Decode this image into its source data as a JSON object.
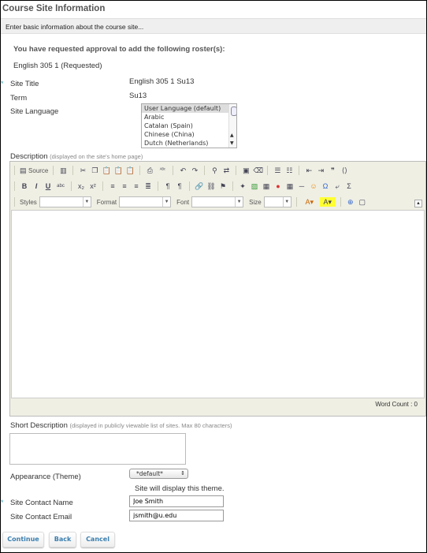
{
  "title": "Course Site Information",
  "instructions": "Enter basic information about the course site...",
  "roster_heading": "You have requested approval to add the following roster(s):",
  "roster_item": "English 305 1 (Requested)",
  "fields": {
    "site_title": {
      "label": "Site Title",
      "value": "English 305 1 Su13",
      "required_mark": "*"
    },
    "term": {
      "label": "Term",
      "value": "Su13"
    },
    "site_language": {
      "label": "Site Language",
      "options": [
        "User Language (default)",
        "Arabic",
        "Catalan (Spain)",
        "Chinese (China)",
        "Dutch (Netherlands)"
      ],
      "selected": "User Language (default)"
    },
    "description": {
      "label": "Description",
      "hint": "(displayed on the site's home page)",
      "word_count": "Word Count : 0"
    },
    "short_description": {
      "label": "Short Description",
      "hint": "(displayed in publicly viewable list of sites. Max 80 characters)",
      "value": ""
    },
    "appearance": {
      "label": "Appearance (Theme)",
      "selected": "*default*",
      "note": "Site will display this theme."
    },
    "contact_name": {
      "label": "Site Contact Name",
      "value": "Joe Smith",
      "required_mark": "*"
    },
    "contact_email": {
      "label": "Site Contact Email",
      "value": "jsmith@u.edu"
    }
  },
  "toolbar": {
    "source_label": "Source",
    "styles_label": "Styles",
    "format_label": "Format",
    "font_label": "Font",
    "size_label": "Size",
    "row1": [
      "source-icon",
      "|",
      "templates-icon",
      "|",
      "cut-icon",
      "copy-icon",
      "paste-icon",
      "paste-text-icon",
      "paste-word-icon",
      "|",
      "print-icon",
      "spellcheck-icon",
      "|",
      "undo-icon",
      "redo-icon",
      "|",
      "find-icon",
      "replace-icon",
      "|",
      "select-all-icon",
      "remove-format-icon",
      "|",
      "numbered-list-icon",
      "bulleted-list-icon",
      "|",
      "outdent-icon",
      "indent-icon",
      "blockquote-icon",
      "div-icon"
    ],
    "row2": [
      "bold-icon",
      "italic-icon",
      "underline-icon",
      "strike-icon",
      "|",
      "subscript-icon",
      "superscript-icon",
      "|",
      "align-left-icon",
      "align-center-icon",
      "align-right-icon",
      "justify-icon",
      "|",
      "ltr-icon",
      "rtl-icon",
      "|",
      "link-icon",
      "unlink-icon",
      "anchor-icon",
      "|",
      "media-icon",
      "image-icon",
      "flash-icon",
      "record-icon",
      "table-icon",
      "horizontal-rule-icon",
      "smiley-icon",
      "special-char-icon",
      "page-break-icon",
      "math-icon"
    ],
    "glyphs": {
      "source-icon": "▤",
      "templates-icon": "▥",
      "cut-icon": "✂",
      "copy-icon": "❐",
      "paste-icon": "📋",
      "paste-text-icon": "📋",
      "paste-word-icon": "📋",
      "print-icon": "⎙",
      "spellcheck-icon": "ᴬᴮᶜ",
      "undo-icon": "↶",
      "redo-icon": "↷",
      "find-icon": "⚲",
      "replace-icon": "⇄",
      "select-all-icon": "▣",
      "remove-format-icon": "⌫",
      "numbered-list-icon": "☰",
      "bulleted-list-icon": "☷",
      "outdent-icon": "⇤",
      "indent-icon": "⇥",
      "blockquote-icon": "❞",
      "div-icon": "⟨⟩",
      "bold-icon": "B",
      "italic-icon": "I",
      "underline-icon": "U",
      "strike-icon": "abc",
      "subscript-icon": "x₂",
      "superscript-icon": "x²",
      "align-left-icon": "≡",
      "align-center-icon": "≡",
      "align-right-icon": "≡",
      "justify-icon": "≣",
      "ltr-icon": "¶",
      "rtl-icon": "¶",
      "link-icon": "🔗",
      "unlink-icon": "⛓",
      "anchor-icon": "⚑",
      "media-icon": "✦",
      "image-icon": "▨",
      "flash-icon": "▦",
      "record-icon": "●",
      "table-icon": "▦",
      "horizontal-rule-icon": "─",
      "smiley-icon": "☺",
      "special-char-icon": "Ω",
      "page-break-icon": "⤶",
      "math-icon": "Σ",
      "text-color-icon": "A",
      "bg-color-icon": "A",
      "maximize-icon": "⊕",
      "show-blocks-icon": "▢"
    }
  },
  "buttons": {
    "continue": "Continue",
    "back": "Back",
    "cancel": "Cancel"
  },
  "colors": {
    "required": "#44aabb",
    "button_text": "#3a7fb0"
  }
}
